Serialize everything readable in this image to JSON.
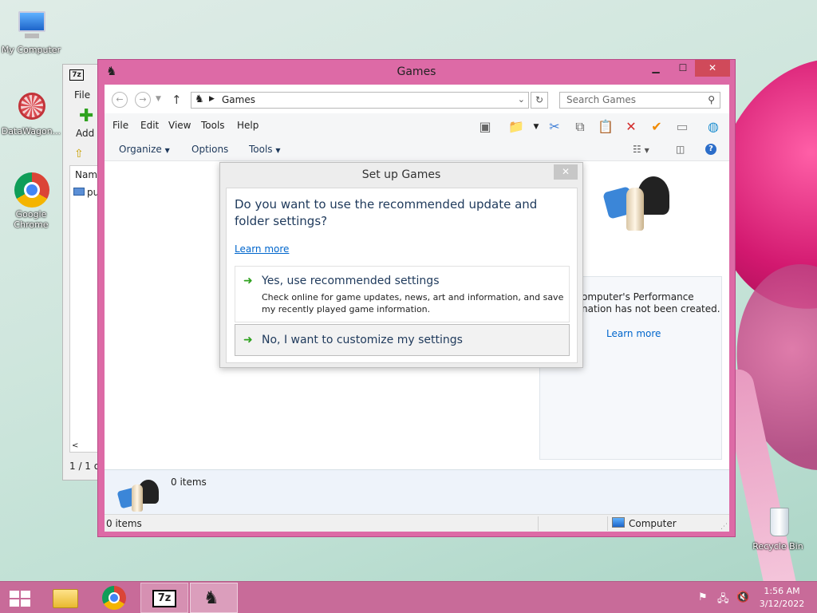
{
  "desktop": {
    "icons": [
      {
        "label": "My Computer"
      },
      {
        "label": "DataWagon..."
      },
      {
        "label": "Google Chrome"
      },
      {
        "label": "Recycle Bin"
      }
    ]
  },
  "bg_window": {
    "menu_file": "File",
    "add_label": "Add",
    "col_name": "Name",
    "row_name": "pu",
    "status": "1 / 1 o",
    "logo": "7z"
  },
  "window": {
    "title": "Games",
    "path": "Games",
    "search_placeholder": "Search Games",
    "menu": [
      "File",
      "Edit",
      "View",
      "Tools",
      "Help"
    ],
    "cmd": {
      "organize": "Organize",
      "options": "Options",
      "tools": "Tools"
    },
    "info": {
      "line1": "omputer's Performance",
      "line2": "nation has not been created.",
      "learn_more": "Learn more"
    },
    "details": {
      "count": "0 items"
    },
    "status": {
      "left": "0 items",
      "right": "Computer"
    }
  },
  "dialog": {
    "title": "Set up Games",
    "question": "Do you want to use the recommended update and folder settings?",
    "learn_more": "Learn more",
    "option_yes": {
      "title": "Yes, use recommended settings",
      "desc": "Check online for game updates, news, art and information, and save my recently played game information."
    },
    "option_no": {
      "title": "No, I want to customize my settings"
    }
  },
  "taskbar": {
    "time": "1:56 AM",
    "date": "3/12/2022",
    "sevenzip": "7z"
  },
  "colors": {
    "accent": "#dd6aa6",
    "link": "#0066cc",
    "heading": "#1e395b",
    "green": "#2fa21f"
  }
}
